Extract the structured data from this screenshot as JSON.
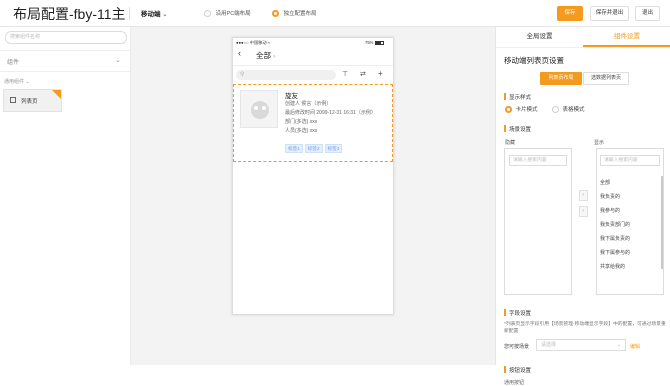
{
  "header": {
    "title": "布局配置-fby-11主",
    "device": "移动端",
    "mode_options": [
      "沿用PC端布局",
      "独立配置布局"
    ],
    "buttons": {
      "save": "保存",
      "save_exit": "保存并退出",
      "exit": "退出"
    }
  },
  "left_panel": {
    "search_placeholder": "搜索组件名称",
    "section_title": "组件",
    "group_title": "通用组件",
    "items": [
      {
        "label": "列表页"
      }
    ]
  },
  "phone": {
    "status_left": "●●●○○ 中国移动",
    "status_time": "",
    "status_battery": "75%",
    "nav_title": "全部",
    "card": {
      "name": "旋友",
      "rows": [
        "创建人 侯言（示例）",
        "最后修改时间 2099-12-31 16:31（示例）",
        "部门(多选) xxx",
        "人员(多选) xxx"
      ],
      "tags": [
        "标签1",
        "标签2",
        "标签3"
      ]
    }
  },
  "right_panel": {
    "tabs": [
      "全局设置",
      "组件设置"
    ],
    "section_title": "移动端列表页设置",
    "toggle": [
      "列表页布局",
      "选数据列表页"
    ],
    "display_style": {
      "label": "显示样式",
      "options": [
        "卡片模式",
        "表格模式"
      ]
    },
    "scene": {
      "label": "场景设置",
      "hidden_label": "隐藏",
      "shown_label": "显示",
      "search_placeholder": "请输入搜索内容",
      "shown_items": [
        "全部",
        "我负责的",
        "我参与的",
        "我负责部门的",
        "我下属负责的",
        "我下属参与的",
        "共享给我的"
      ]
    },
    "field": {
      "label": "字段设置",
      "desc": "*列表页显示字段引用【场景管理-移动端显示字段】中的配置，可通过场景重新配置",
      "select_label": "您可按场景",
      "select_placeholder": "请选择",
      "link": "编辑"
    },
    "button": {
      "label": "按钮设置",
      "sub": "通用按钮"
    }
  },
  "colors": {
    "accent": "#f39a1f",
    "bg": "#f3f3f3"
  }
}
